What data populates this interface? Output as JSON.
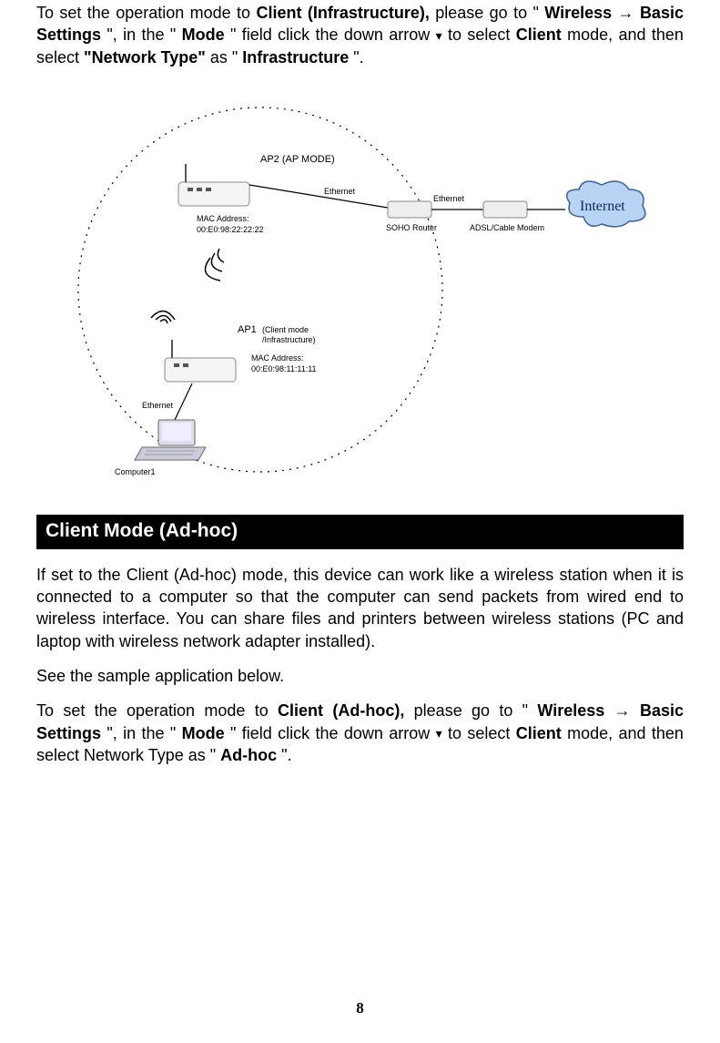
{
  "top_paragraph": {
    "t1": "To set the operation mode to ",
    "b1": "Client (Infrastructure),",
    "t2": " please go to \"",
    "b2": "Wireless",
    "arrow1": " →",
    "b3": "Basic Settings",
    "t3": "\", in the \"",
    "b4": "Mode",
    "t4": "\" field click the down arrow ",
    "arrow_glyph": "▾",
    "t5": " to select ",
    "b5": "Client",
    "t6": " mode, and then select ",
    "b6": "\"Network Type\"",
    "t7": " as \"",
    "b7": "Infrastructure",
    "t8": "\"."
  },
  "diagram": {
    "ap2_label": "AP2 (AP MODE)",
    "ap2_mac_label": "MAC Address:",
    "ap2_mac_value": "00:E0:98:22:22:22",
    "eth_label": "Ethernet",
    "soho_router": "SOHO Router",
    "adsl_modem": "ADSL/Cable Modem",
    "internet": "Internet",
    "ap1_label": "AP1",
    "ap1_mode": "(Client mode /Infrastructure)",
    "ap1_mac_label": "MAC Address:",
    "ap1_mac_value": "00:E0:98:11:11:11",
    "computer1": "Computer1"
  },
  "section_heading": "Client Mode (Ad-hoc)",
  "para2": "If set to the Client (Ad-hoc) mode, this device can work like a wireless station when it is connected to a computer so that the computer can send packets from wired end to wireless interface.  You can share files and printers between wireless stations  (PC and laptop with wireless network adapter installed).",
  "para3": "See the sample application below.",
  "bottom_paragraph": {
    "t1": "To set the operation mode to ",
    "b1": "Client (Ad-hoc),",
    "t2": " please go to \"",
    "b2": "Wireless",
    "arrow1": " →",
    "b3": "Basic Settings",
    "t3": "\", in the \"",
    "b4": "Mode",
    "t4": "\" field click the down arrow ",
    "arrow_glyph": "▾",
    "t5": " to select ",
    "b5": "Client",
    "t6": " mode, and then select Network Type as \"",
    "b7": "Ad-hoc",
    "t8": "\"."
  },
  "page_number": "8"
}
